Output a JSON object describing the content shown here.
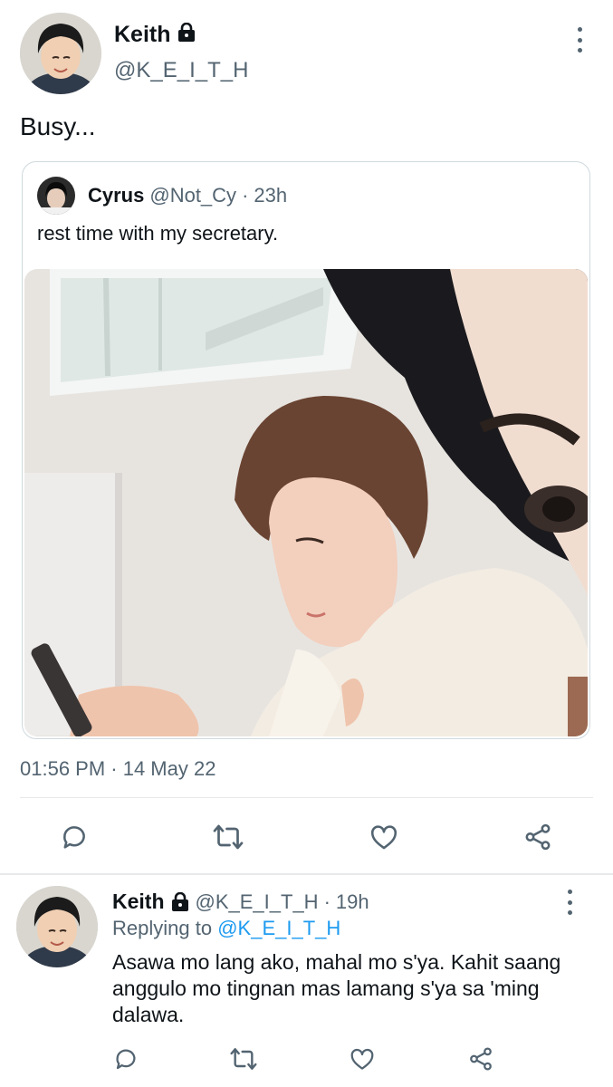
{
  "main_tweet": {
    "author_name": "Keith",
    "author_handle": "@K_E_I_T_H",
    "locked": true,
    "text": "Busy...",
    "timestamp": "01:56 PM · 14 May 22"
  },
  "quoted_tweet": {
    "author_name": "Cyrus",
    "author_handle": "@Not_Cy",
    "time": "23h",
    "separator": "·",
    "text": "rest time with my secretary."
  },
  "actions": [
    "reply-icon",
    "retweet-icon",
    "like-icon",
    "share-icon"
  ],
  "reply_tweet": {
    "author_name": "Keith",
    "author_handle": "@K_E_I_T_H",
    "separator": "·",
    "time": "19h",
    "replying_to_prefix": "Replying to",
    "replying_to_handle": "@K_E_I_T_H",
    "text": "Asawa mo lang ako, mahal mo s'ya. Kahit saang anggulo mo tingnan mas lamang s'ya sa 'ming dalawa."
  },
  "colors": {
    "link": "#1d9bf0",
    "secondary_text": "#536471",
    "border": "#cfd9de"
  }
}
